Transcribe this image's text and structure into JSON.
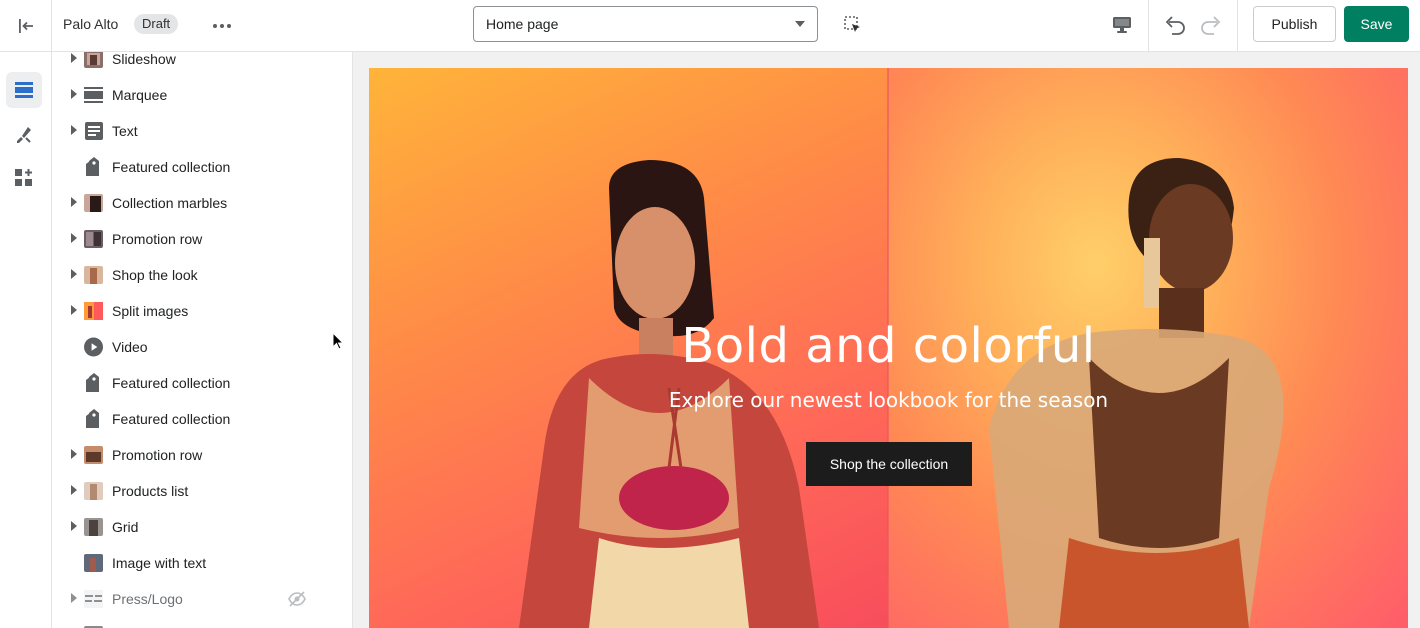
{
  "topbar": {
    "store_name": "Palo Alto",
    "status_badge": "Draft",
    "page_select": {
      "value": "Home page"
    },
    "publish_label": "Publish",
    "save_label": "Save"
  },
  "rail": {
    "items": [
      {
        "icon": "sections-icon",
        "active": true
      },
      {
        "icon": "theme-settings-icon",
        "active": false
      },
      {
        "icon": "app-embeds-icon",
        "active": false
      }
    ]
  },
  "sections": [
    {
      "label": "Slideshow",
      "expandable": true,
      "icon": "slideshow-thumbnail"
    },
    {
      "label": "Marquee",
      "expandable": true,
      "icon": "marquee-icon"
    },
    {
      "label": "Text",
      "expandable": true,
      "icon": "text-block-icon"
    },
    {
      "label": "Featured collection",
      "expandable": false,
      "icon": "tag-icon"
    },
    {
      "label": "Collection marbles",
      "expandable": true,
      "icon": "collection-marbles-thumbnail"
    },
    {
      "label": "Promotion row",
      "expandable": true,
      "icon": "promotion-row-thumbnail"
    },
    {
      "label": "Shop the look",
      "expandable": true,
      "icon": "shop-the-look-thumbnail"
    },
    {
      "label": "Split images",
      "expandable": true,
      "icon": "split-images-thumbnail"
    },
    {
      "label": "Video",
      "expandable": false,
      "icon": "play-icon"
    },
    {
      "label": "Featured collection",
      "expandable": false,
      "icon": "tag-icon"
    },
    {
      "label": "Featured collection",
      "expandable": false,
      "icon": "tag-icon"
    },
    {
      "label": "Promotion row",
      "expandable": true,
      "icon": "promotion-row-thumbnail"
    },
    {
      "label": "Products list",
      "expandable": true,
      "icon": "products-list-thumbnail"
    },
    {
      "label": "Grid",
      "expandable": true,
      "icon": "grid-thumbnail"
    },
    {
      "label": "Image with text",
      "expandable": false,
      "icon": "image-with-text-thumbnail"
    },
    {
      "label": "Press/Logo",
      "expandable": true,
      "icon": "press-logo-thumbnail",
      "hidden": true
    }
  ],
  "preview": {
    "hero_title": "Bold and colorful",
    "hero_subtitle": "Explore our newest lookbook for the season",
    "hero_button": "Shop the collection"
  },
  "colors": {
    "accent": "#008060",
    "hero_gradient": [
      "#ffb238",
      "#ff6a52",
      "#ff4f6a"
    ]
  }
}
